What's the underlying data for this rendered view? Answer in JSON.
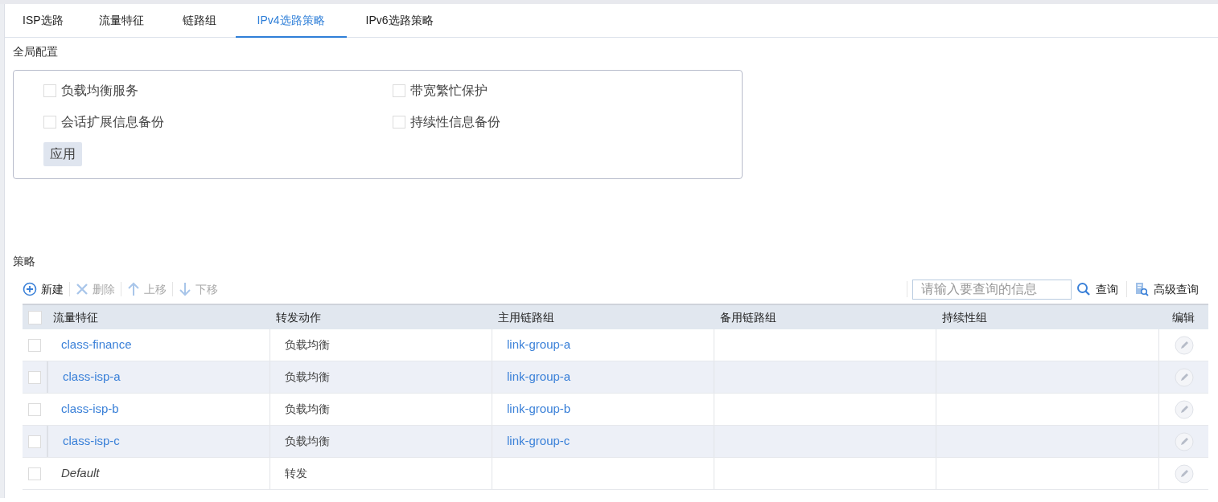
{
  "tabs": [
    {
      "label": "ISP选路",
      "selected": false
    },
    {
      "label": "流量特征",
      "selected": false
    },
    {
      "label": "链路组",
      "selected": false
    },
    {
      "label": "IPv4选路策略",
      "selected": true
    },
    {
      "label": "IPv6选路策略",
      "selected": false
    }
  ],
  "global_config": {
    "title": "全局配置",
    "options": [
      {
        "label": "负载均衡服务",
        "checked": false
      },
      {
        "label": "带宽繁忙保护",
        "checked": false
      },
      {
        "label": "会话扩展信息备份",
        "checked": false
      },
      {
        "label": "持续性信息备份",
        "checked": false
      }
    ],
    "apply_button": "应用"
  },
  "policy": {
    "title": "策略",
    "toolbar": [
      {
        "kind": "add",
        "label": "新建",
        "disabled": false
      },
      {
        "kind": "delete",
        "label": "删除",
        "disabled": true
      },
      {
        "kind": "up",
        "label": "上移",
        "disabled": true
      },
      {
        "kind": "down",
        "label": "下移",
        "disabled": true
      }
    ],
    "search": {
      "placeholder": "请输入要查询的信息",
      "button": "查询",
      "advanced": "高级查询"
    },
    "table": {
      "select_all_checked": false,
      "columns": [
        "流量特征",
        "转发动作",
        "主用链路组",
        "备用链路组",
        "持续性组",
        "编辑"
      ],
      "rows": [
        {
          "kind": "link",
          "checked": false,
          "cells": [
            "class-finance",
            "负载均衡",
            "link-group-a"
          ]
        },
        {
          "kind": "link",
          "checked": false,
          "cells": [
            "class-isp-a",
            "负载均衡",
            "link-group-a"
          ]
        },
        {
          "kind": "link",
          "checked": false,
          "cells": [
            "class-isp-b",
            "负载均衡",
            "link-group-b"
          ]
        },
        {
          "kind": "link",
          "checked": false,
          "cells": [
            "class-isp-c",
            "负载均衡",
            "link-group-c"
          ]
        },
        {
          "kind": "default",
          "checked": false,
          "cells": [
            "Default",
            "转发",
            ""
          ]
        }
      ]
    }
  }
}
